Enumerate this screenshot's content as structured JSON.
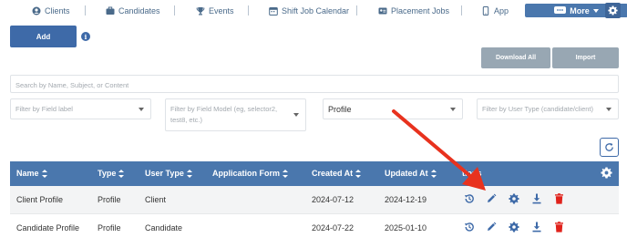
{
  "nav": {
    "items": [
      {
        "label": "Clients",
        "icon": "users-icon"
      },
      {
        "label": "Candidates",
        "icon": "briefcase-icon"
      },
      {
        "label": "Events",
        "icon": "trophy-icon"
      },
      {
        "label": "Shift Job Calendar",
        "icon": "calendar-icon"
      },
      {
        "label": "Placement Jobs",
        "icon": "id-card-icon"
      },
      {
        "label": "App",
        "icon": "mobile-icon"
      }
    ],
    "more_label": "More"
  },
  "toolbar": {
    "add_label": "Add",
    "download_all_label": "Download All",
    "import_label": "Import"
  },
  "search": {
    "placeholder": "Search by Name, Subject, or Content"
  },
  "filters": {
    "field_label_placeholder": "Filter by Field label",
    "field_model_placeholder": "Filter by Field Model (eg, selector2, test8, etc.)",
    "type_selected": "Profile",
    "user_type_placeholder": "Filter by User Type (candidate/client)"
  },
  "table": {
    "columns": [
      "Name",
      "Type",
      "User Type",
      "Application Form",
      "Created At",
      "Updated At",
      "Actions"
    ],
    "actions_partial": "tions",
    "rows": [
      {
        "name": "Client Profile",
        "type": "Profile",
        "user_type": "Client",
        "application_form": "",
        "created_at": "2024-07-12",
        "updated_at": "2024-12-19"
      },
      {
        "name": "Candidate Profile",
        "type": "Profile",
        "user_type": "Candidate",
        "application_form": "",
        "created_at": "2024-07-22",
        "updated_at": "2025-01-10"
      }
    ]
  },
  "colors": {
    "primary": "#3e6aa8",
    "header": "#4a77ad",
    "muted_button": "#98a7b3",
    "delete": "#e0221b",
    "annotation_arrow": "#e8321e"
  }
}
